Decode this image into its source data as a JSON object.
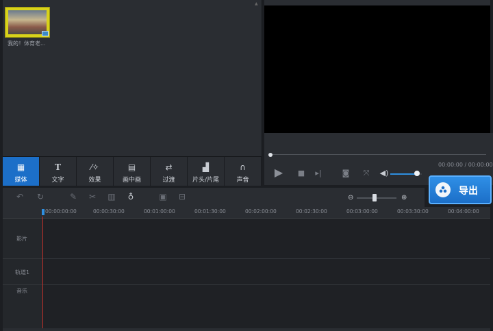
{
  "media": {
    "items": [
      {
        "caption": "我的！体育老..."
      }
    ]
  },
  "tabs": [
    {
      "label": "媒体",
      "icon": "media-film-icon",
      "active": true
    },
    {
      "label": "文字",
      "icon": "text-T-icon",
      "active": false
    },
    {
      "label": "效果",
      "icon": "magic-wand-icon",
      "active": false
    },
    {
      "label": "画中画",
      "icon": "picture-in-picture-icon",
      "active": false
    },
    {
      "label": "过渡",
      "icon": "transition-icon",
      "active": false
    },
    {
      "label": "片头/片尾",
      "icon": "clapperboard-icon",
      "active": false
    },
    {
      "label": "声音",
      "icon": "headphones-icon",
      "active": false
    }
  ],
  "preview": {
    "time": "00:00:00 / 00:00:00",
    "volume": 0.85
  },
  "export": {
    "label": "导出"
  },
  "timeline": {
    "zoom": 0.45,
    "ruler": [
      "00:00:00:00",
      "00:00:30:00",
      "00:01:00:00",
      "00:01:30:00",
      "00:02:00:00",
      "00:02:30:00",
      "00:03:00:00",
      "00:03:30:00",
      "00:04:00:00"
    ],
    "tracks": [
      {
        "label": "影片"
      },
      {
        "label": "轨道1"
      },
      {
        "label": "音乐"
      }
    ]
  },
  "colors": {
    "accent": "#1c6fc8",
    "playhead": "#c0302a",
    "volume": "#2f8fe0"
  }
}
